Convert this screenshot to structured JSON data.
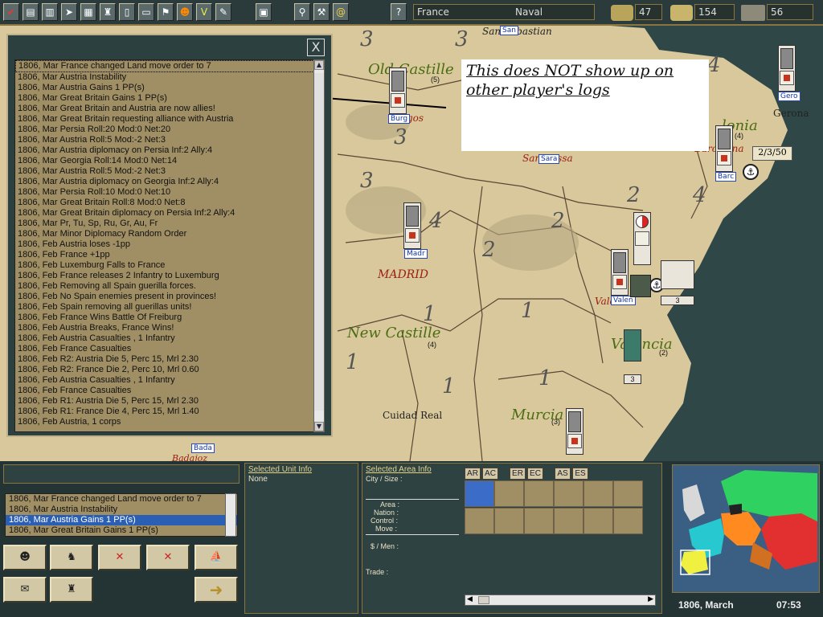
{
  "toolbar": {
    "buttons": [
      "check-icon",
      "map-icon",
      "chart-icon",
      "cursor-icon",
      "grid-icon",
      "tower-icon",
      "book-icon",
      "scroll-icon",
      "flag-icon",
      "soldier-icon",
      "v-icon",
      "pen-icon",
      "book2-icon",
      "search-icon",
      "tools-icon",
      "at-icon",
      "help-icon"
    ],
    "help_label": "?",
    "nation": "France",
    "phase": "Naval",
    "money": "47",
    "manpower": "154",
    "troops": "56"
  },
  "log": {
    "entries": [
      "1806, Mar France changed Land move order to 7",
      "1806, Mar Austria Instability",
      "1806, Mar Austria Gains 1 PP(s)",
      "1806, Mar Great Britain Gains 1 PP(s)",
      "1806, Mar Great Britain and Austria are now allies!",
      "1806, Mar Great Britain requesting alliance with Austria",
      "1806, Mar Persia Roll:20 Mod:0 Net:20",
      "1806, Mar Austria Roll:5 Mod:-2 Net:3",
      "1806, Mar Austria diplomacy on Persia Inf:2 Ally:4",
      "1806, Mar Georgia Roll:14 Mod:0 Net:14",
      "1806, Mar Austria Roll:5 Mod:-2 Net:3",
      "1806, Mar Austria diplomacy on Georgia Inf:2 Ally:4",
      "1806, Mar Persia Roll:10 Mod:0 Net:10",
      "1806, Mar Great Britain Roll:8 Mod:0 Net:8",
      "1806, Mar Great Britain diplomacy on Persia Inf:2 Ally:4",
      "1806, Mar Pr, Tu, Sp, Ru, Gr, Au, Fr",
      "1806, Mar Minor Diplomacy Random Order",
      "1806, Feb Austria loses -1pp",
      "1806, Feb France +1pp",
      "1806, Feb Luxemburg Falls to France",
      "1806, Feb France releases 2 Infantry to Luxemburg",
      "1806, Feb Removing all Spain guerilla forces.",
      "1806, Feb No Spain enemies present in provinces!",
      "1806, Feb Spain removing all guerillas units!",
      "1806, Feb France Wins Battle Of Freiburg",
      "1806, Feb Austria Breaks, France Wins!",
      "1806, Feb Austria Casualties , 1 Infantry",
      "1806, Feb France Casualties",
      "1806, Feb R2: Austria Die 5, Perc 15, Mrl 2.30",
      "1806, Feb R2: France Die 2, Perc 10, Mrl 0.60",
      "1806, Feb Austria Casualties , 1 Infantry",
      "1806, Feb France Casualties",
      "1806, Feb R1: Austria Die 5, Perc 15, Mrl 2.30",
      "1806, Feb R1: France Die 4, Perc 15, Mrl 1.40",
      "1806, Feb Austria, 1 corps"
    ],
    "close_label": "X"
  },
  "annotation": "This does NOT show up on other player's logs",
  "map": {
    "labels": {
      "old_castille": "Old Castille",
      "san_sebastian": "San Sebastian",
      "gerona": "Gerona",
      "catalonia_suffix": "lonia",
      "barcelona": "Barcelona",
      "saragossa": "Saragossa",
      "madrid": "MADRID",
      "new_castille": "New Castille",
      "valencia_city": "Valencia",
      "valencia_region": "Valencia",
      "cuidad_real": "Cuidad Real",
      "murcia": "Murcia",
      "badajoz": "Badajoz",
      "burgos_suffix": "gos",
      "garrison": "2/3/50"
    },
    "tags": {
      "burg": "Burg",
      "gero": "Gero",
      "barc": "Barc",
      "sara": "Sara",
      "madr": "Madr",
      "valen": "Valen",
      "bada": "Bada",
      "san": "San"
    },
    "small_counts": {
      "c5": "(5)",
      "c4a": "(4)",
      "c4b": "(4)",
      "c2": "(2)",
      "c3": "(3)",
      "stack1": "3",
      "stack2": "3"
    }
  },
  "bottom": {
    "mini_log": [
      "1806, Mar France changed Land move order to 7",
      "1806, Mar Austria Instability",
      "1806, Mar Austria Gains 1 PP(s)",
      "1806, Mar Great Britain Gains 1 PP(s)"
    ],
    "selected_unit_title": "Selected Unit Info",
    "selected_unit_value": "None",
    "selected_area_title": "Selected Area Info",
    "city_size": "City / Size :",
    "area": "Area :",
    "nation": "Nation :",
    "control": "Control :",
    "move": "Move :",
    "money_men": "$ / Men :",
    "trade": "Trade :",
    "tabs": [
      "AR",
      "AC",
      "ER",
      "EC",
      "AS",
      "ES"
    ],
    "date": "1806, March",
    "time": "07:53"
  },
  "colors": {
    "panel": "#2f4242",
    "gold": "#8a7440",
    "map": "#d8c89c"
  }
}
